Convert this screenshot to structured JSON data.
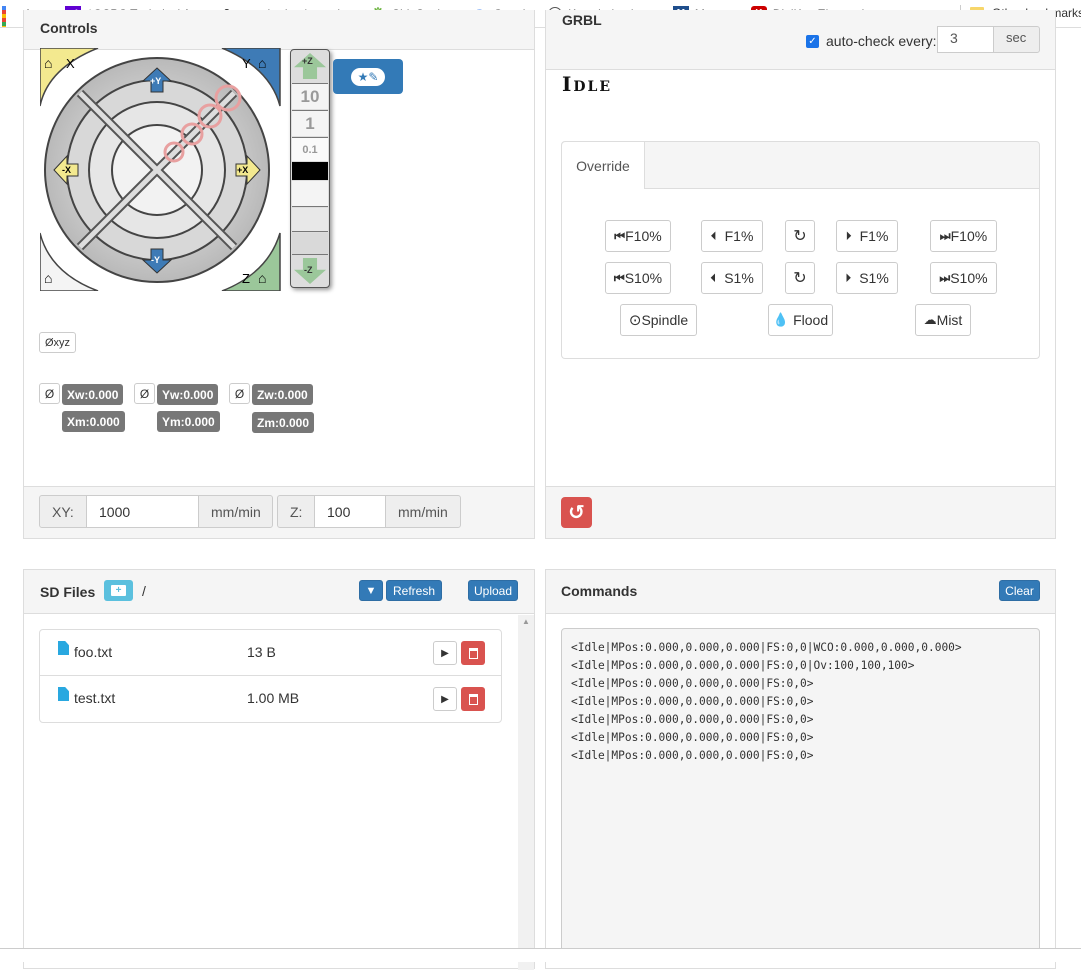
{
  "bookmarks": {
    "items": [
      "Apps",
      "^GSPC Technical A...",
      "zero hedge | on a l...",
      "ShipStation",
      "Google",
      "Knowledge base",
      "Mouser",
      "DigiKey Electronics..."
    ],
    "more": "»",
    "other": "Other bookmarks"
  },
  "controls": {
    "title": "Controls",
    "jog": {
      "x_home": "X",
      "y_home": "Y",
      "z_home": "Z",
      "plus_y": "+Y",
      "minus_y": "-Y",
      "plus_x": "+X",
      "minus_x": "-X",
      "plus_z": "+Z",
      "minus_z": "-Z",
      "steps": [
        "10",
        "1",
        "0.1"
      ]
    },
    "zero_all_label": "Øxyz",
    "zero_label": "Ø",
    "coords": {
      "xw": "Xw:0.000",
      "yw": "Yw:0.000",
      "zw": "Zw:0.000",
      "xm": "Xm:0.000",
      "ym": "Ym:0.000",
      "zm": "Zm:0.000"
    },
    "feed": {
      "xy_label": "XY:",
      "xy_value": "1000",
      "xy_unit": "mm/min",
      "z_label": "Z:",
      "z_value": "100",
      "z_unit": "mm/min"
    }
  },
  "grbl": {
    "title": "GRBL",
    "autocheck_label": "auto-check every:",
    "autocheck_value": "3",
    "autocheck_unit": "sec",
    "state": "Idle",
    "tab_override": "Override",
    "feed_row": [
      "F10%",
      "F1%",
      "F1%",
      "F10%"
    ],
    "spindle_row": [
      "S10%",
      "S1%",
      "S1%",
      "S10%"
    ],
    "spindle": "Spindle",
    "flood": "Flood",
    "mist": "Mist"
  },
  "sd": {
    "title": "SD Files",
    "path": "/",
    "refresh": "Refresh",
    "upload": "Upload",
    "files": [
      {
        "name": "foo.txt",
        "size": "13 B"
      },
      {
        "name": "test.txt",
        "size": "1.00 MB"
      }
    ]
  },
  "commands": {
    "title": "Commands",
    "clear": "Clear",
    "lines": [
      "<Idle|MPos:0.000,0.000,0.000|FS:0,0|WCO:0.000,0.000,0.000>",
      "<Idle|MPos:0.000,0.000,0.000|FS:0,0|Ov:100,100,100>",
      "<Idle|MPos:0.000,0.000,0.000|FS:0,0>",
      "<Idle|MPos:0.000,0.000,0.000|FS:0,0>",
      "<Idle|MPos:0.000,0.000,0.000|FS:0,0>",
      "<Idle|MPos:0.000,0.000,0.000|FS:0,0>",
      "<Idle|MPos:0.000,0.000,0.000|FS:0,0>"
    ]
  },
  "colors": {
    "primary": "#337ab7",
    "danger": "#d9534f",
    "badge": "#777777",
    "jog_x": "#f3e98f",
    "jog_y": "#3e7bb6",
    "jog_z": "#9bc79a"
  }
}
